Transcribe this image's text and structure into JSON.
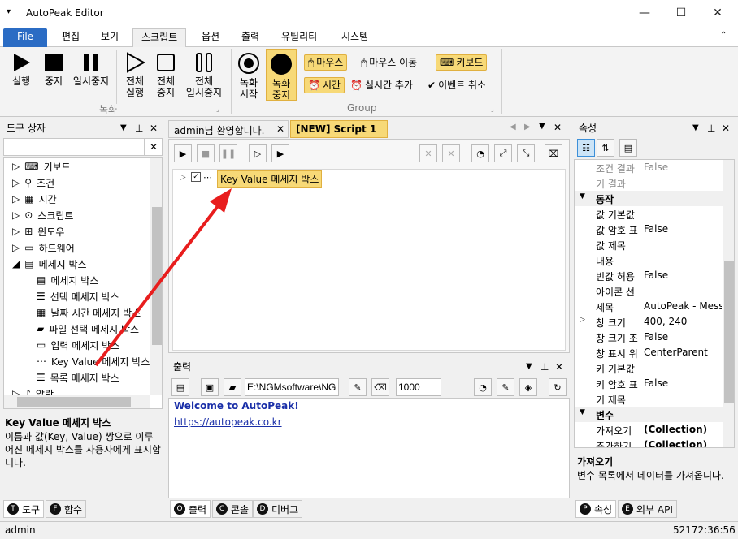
{
  "app": {
    "title": "AutoPeak Editor"
  },
  "menu": {
    "file": "File",
    "tabs": [
      "편집",
      "보기",
      "스크립트",
      "옵션",
      "출력",
      "유틸리티",
      "시스템"
    ]
  },
  "ribbon": {
    "run": "실행",
    "stop": "중지",
    "pause": "일시중지",
    "run_all_1": "전체",
    "run_all_2": "실행",
    "stop_all_1": "전체",
    "stop_all_2": "중지",
    "pause_all_1": "전체",
    "pause_all_2": "일시중지",
    "record_start_1": "녹화",
    "record_start_2": "시작",
    "record_stop_1": "녹화",
    "record_stop_2": "중지",
    "group_record": "녹화",
    "group_group": "Group",
    "mouse": "마우스",
    "mouse_move": "마우스 이동",
    "keyboard": "키보드",
    "time": "시간",
    "realtime_add": "실시간 추가",
    "event_cancel": "이벤트 취소"
  },
  "toolbox": {
    "title": "도구 상자",
    "search_value": "",
    "items": [
      "키보드",
      "조건",
      "시간",
      "스크립트",
      "윈도우",
      "하드웨어",
      "메세지 박스",
      "메세지 박스",
      "선택 메세지 박스",
      "날짜 시간 메세지 박스",
      "파일 선택 메세지 박스",
      "입력 메세지 박스",
      "Key Value 메세지 박스",
      "목록 메세지 박스",
      "알람"
    ],
    "desc_title": "Key Value 메세지 박스",
    "desc_text": "이름과 값(Key, Value) 쌍으로 이루어진 메세지 박스를 사용자에게 표시합니다.",
    "tab_tools": "도구",
    "tab_functions": "함수"
  },
  "editor": {
    "tab1": "admin님 환영합니다.",
    "tab2": "[NEW] Script 1",
    "node_label": "Key Value 메세지 박스"
  },
  "output": {
    "title": "출력",
    "path": "E:\\NGMsoftware\\NG",
    "count": "1000",
    "line1": "Welcome to AutoPeak!",
    "line2": "https://autopeak.co.kr",
    "tab_output": "출력",
    "tab_console": "콘솔",
    "tab_debug": "디버그"
  },
  "props": {
    "title": "속성",
    "rows": [
      {
        "k": "조건 결과",
        "v": "False",
        "gray": true
      },
      {
        "k": "키 결과",
        "v": "",
        "gray": true
      },
      {
        "cat": "동작"
      },
      {
        "k": "값 기본값",
        "v": ""
      },
      {
        "k": "값 암호 표",
        "v": "False"
      },
      {
        "k": "값 제목",
        "v": ""
      },
      {
        "k": "내용",
        "v": ""
      },
      {
        "k": "빈값 허용",
        "v": "False"
      },
      {
        "k": "아이콘 선",
        "v": ""
      },
      {
        "k": "제목",
        "v": "AutoPeak - Messa"
      },
      {
        "k": "창 크기",
        "v": "400, 240",
        "exp": true
      },
      {
        "k": "창 크기 조",
        "v": "False"
      },
      {
        "k": "창 표시 위",
        "v": "CenterParent"
      },
      {
        "k": "키 기본값",
        "v": ""
      },
      {
        "k": "키 암호 표",
        "v": "False"
      },
      {
        "k": "키 제목",
        "v": ""
      },
      {
        "cat": "변수"
      },
      {
        "k": "가져오기",
        "v": "(Collection)",
        "bold": true
      },
      {
        "k": "추가하기",
        "v": "(Collection)",
        "bold": true
      }
    ],
    "desc_title": "가져오기",
    "desc_text": "변수 목록에서 데이터를 가져옵니다.",
    "tab_props": "속성",
    "tab_api": "외부 API"
  },
  "status": {
    "user": "admin",
    "time": "52172:36:56"
  }
}
